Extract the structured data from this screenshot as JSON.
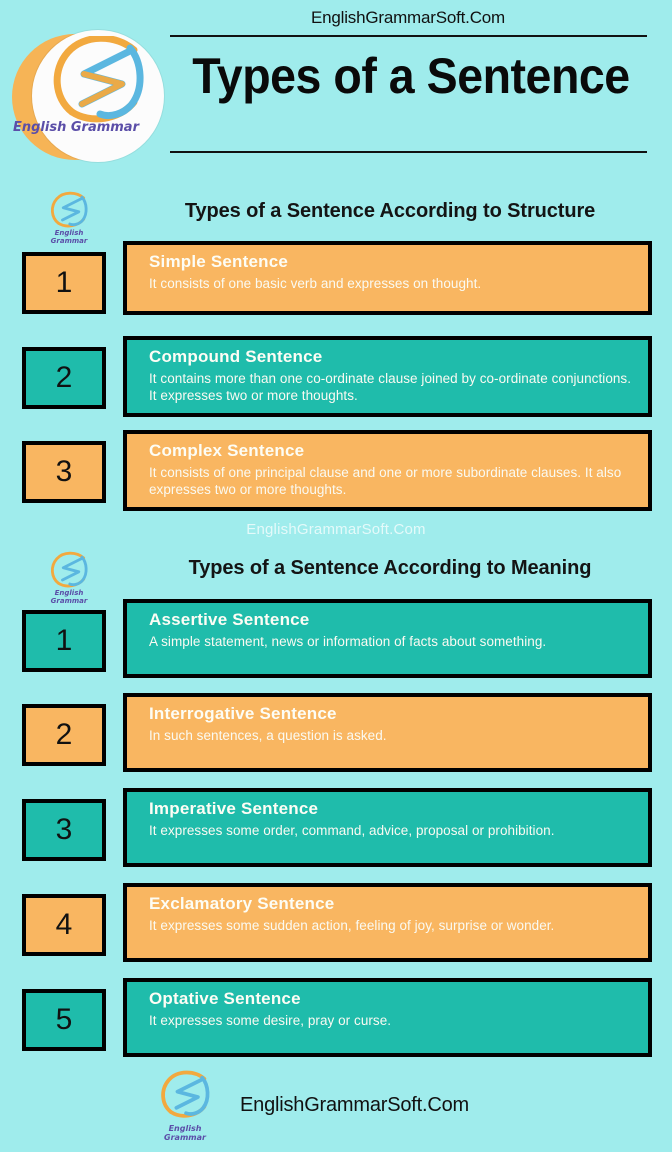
{
  "colors": {
    "background": "#9fecec",
    "orange": "#f9b661",
    "teal": "#1fbcab",
    "border": "#000000",
    "title_text": "#0a0a0a",
    "card_text": "#fdfdf5",
    "logo_purple": "#5b4ea8",
    "logo_orange": "#f2a93f",
    "logo_blue": "#5bb7e0"
  },
  "header": {
    "site_name": "EnglishGrammarSoft.Com",
    "title": "Types of a Sentence",
    "logo_label": "English Grammar",
    "logo_icon": "english-grammar-logo-icon"
  },
  "watermark": {
    "text": "EnglishGrammarSoft.Com"
  },
  "sections": [
    {
      "heading": "Types of a Sentence According to Structure",
      "logo_label": "English Grammar",
      "rows": [
        {
          "number": "1",
          "title": "Simple Sentence",
          "description": "It consists of one basic verb and expresses on thought.",
          "color": "orange"
        },
        {
          "number": "2",
          "title": "Compound Sentence",
          "description": "It contains more than one co-ordinate clause joined by co-ordinate conjunctions. It expresses two or more thoughts.",
          "color": "teal"
        },
        {
          "number": "3",
          "title": "Complex Sentence",
          "description": "It consists of one principal clause and one or more subordinate clauses. It also expresses two or more thoughts.",
          "color": "orange"
        }
      ]
    },
    {
      "heading": "Types of a Sentence According to Meaning",
      "logo_label": "English Grammar",
      "rows": [
        {
          "number": "1",
          "title": "Assertive Sentence",
          "description": "A simple statement, news or information of facts about something.",
          "color": "teal"
        },
        {
          "number": "2",
          "title": "Interrogative Sentence",
          "description": "In such sentences, a question is asked.",
          "color": "orange"
        },
        {
          "number": "3",
          "title": "Imperative Sentence",
          "description": "It expresses some order, command, advice, proposal or prohibition.",
          "color": "teal"
        },
        {
          "number": "4",
          "title": "Exclamatory Sentence",
          "description": "It expresses some sudden action, feeling of joy, surprise or wonder.",
          "color": "orange"
        },
        {
          "number": "5",
          "title": "Optative Sentence",
          "description": "It expresses some desire, pray or curse.",
          "color": "teal"
        }
      ]
    }
  ],
  "footer": {
    "site_name": "EnglishGrammarSoft.Com",
    "logo_label": "English Grammar",
    "logo_icon": "english-grammar-logo-icon"
  }
}
